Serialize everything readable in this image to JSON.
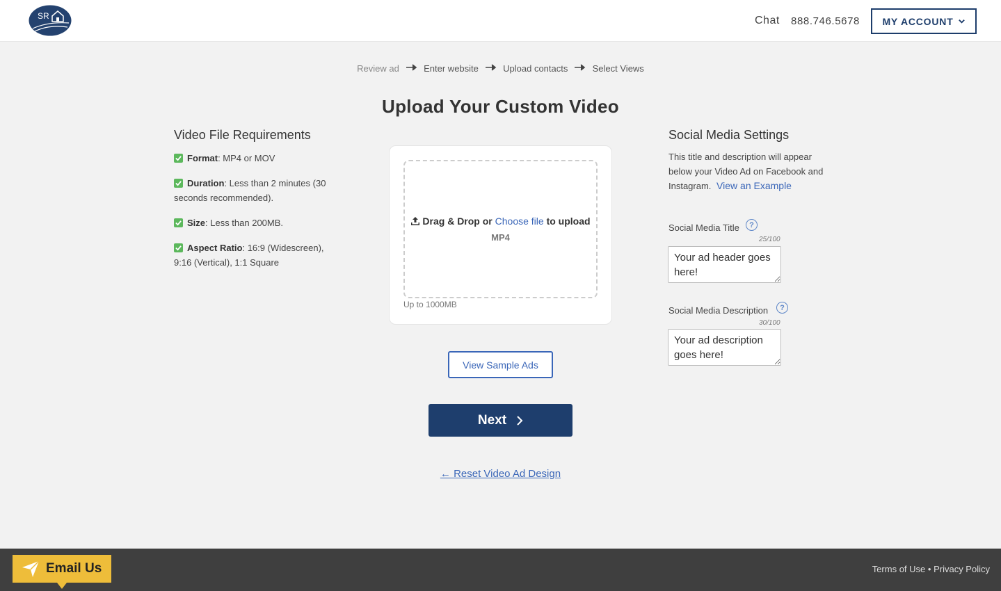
{
  "header": {
    "logo_text": "SR",
    "chat_label": "Chat",
    "phone": "888.746.5678",
    "account_label": "MY ACCOUNT"
  },
  "steps": [
    "Review ad",
    "Enter website",
    "Upload contacts",
    "Select Views"
  ],
  "page_title": "Upload Your Custom Video",
  "requirements": {
    "title": "Video File Requirements",
    "items": [
      {
        "label": "Format",
        "text": ": MP4 or MOV"
      },
      {
        "label": "Duration",
        "text": ": Less than 2 minutes (30 seconds recommended)."
      },
      {
        "label": "Size",
        "text": ": Less than 200MB."
      },
      {
        "label": "Aspect Ratio",
        "text": ": 16:9 (Widescreen), 9:16 (Vertical), 1:1 Square"
      }
    ]
  },
  "upload": {
    "drag_text": "Drag & Drop or",
    "choose_text": "Choose file",
    "to_upload": "to upload",
    "file_type": "MP4",
    "limit": "Up to 1000MB"
  },
  "buttons": {
    "sample": "View Sample Ads",
    "next": "Next",
    "reset": "← Reset Video Ad Design"
  },
  "social": {
    "title": "Social Media Settings",
    "description": "This title and description will appear below your Video Ad on Facebook and Instagram.",
    "example_link": "View an Example",
    "title_label": "Social Media Title",
    "title_counter": "25/100",
    "title_value": "Your ad header goes here!",
    "desc_label": "Social Media Description",
    "desc_counter": "30/100",
    "desc_value": "Your ad description goes here!",
    "help_glyph": "?"
  },
  "footer": {
    "terms": "Terms of Use",
    "separator": "•",
    "privacy": "Privacy Policy",
    "email_us": "Email Us"
  },
  "colors": {
    "brand_navy": "#1e3e6d",
    "link_blue": "#3a66b8",
    "check_green": "#5cb85c",
    "email_yellow": "#eebd3a",
    "footer_bg": "#3f3f3f"
  }
}
